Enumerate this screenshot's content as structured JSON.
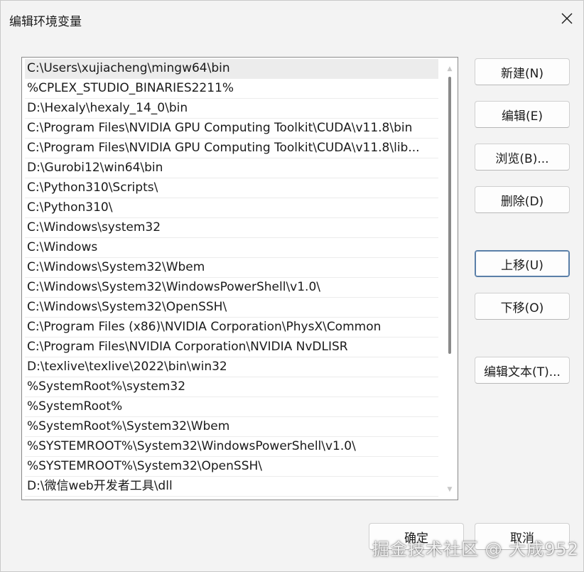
{
  "window": {
    "title": "编辑环境变量",
    "close_icon": "close-icon"
  },
  "path_list": {
    "items": [
      "C:\\Users\\xujiacheng\\mingw64\\bin",
      "%CPLEX_STUDIO_BINARIES2211%",
      "D:\\Hexaly\\hexaly_14_0\\bin",
      "C:\\Program Files\\NVIDIA GPU Computing Toolkit\\CUDA\\v11.8\\bin",
      "C:\\Program Files\\NVIDIA GPU Computing Toolkit\\CUDA\\v11.8\\lib...",
      "D:\\Gurobi12\\win64\\bin",
      "C:\\Python310\\Scripts\\",
      "C:\\Python310\\",
      "C:\\Windows\\system32",
      "C:\\Windows",
      "C:\\Windows\\System32\\Wbem",
      "C:\\Windows\\System32\\WindowsPowerShell\\v1.0\\",
      "C:\\Windows\\System32\\OpenSSH\\",
      "C:\\Program Files (x86)\\NVIDIA Corporation\\PhysX\\Common",
      "C:\\Program Files\\NVIDIA Corporation\\NVIDIA NvDLISR",
      "D:\\texlive\\texlive\\2022\\bin\\win32",
      "%SystemRoot%\\system32",
      "%SystemRoot%",
      "%SystemRoot%\\System32\\Wbem",
      "%SYSTEMROOT%\\System32\\WindowsPowerShell\\v1.0\\",
      "%SYSTEMROOT%\\System32\\OpenSSH\\",
      "D:\\微信web开发者工具\\dll"
    ],
    "selected_index": 0
  },
  "buttons": {
    "new": "新建(N)",
    "edit": "编辑(E)",
    "browse": "浏览(B)...",
    "delete": "删除(D)",
    "move_up": "上移(U)",
    "move_down": "下移(O)",
    "edit_text": "编辑文本(T)...",
    "ok": "确定",
    "cancel": "取消"
  },
  "watermark": "掘金技术社区 @ 大成952"
}
